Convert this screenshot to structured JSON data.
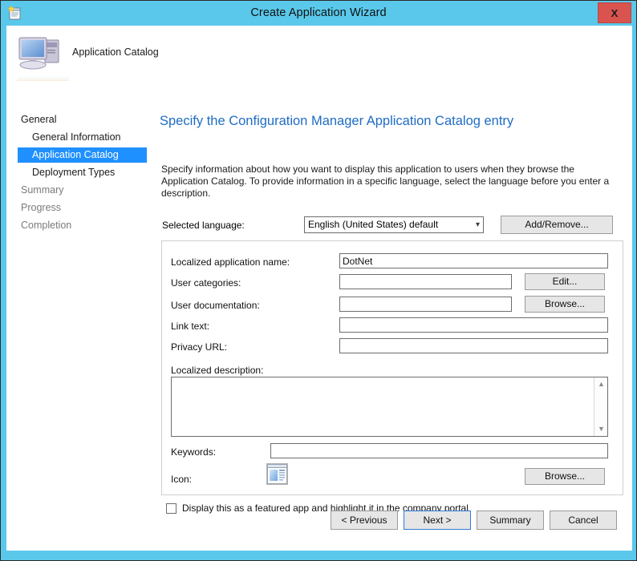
{
  "window": {
    "title": "Create Application Wizard",
    "close_label": "X",
    "icon": "wizard-document-icon",
    "titlebar_color": "#5ac8ea",
    "close_color": "#d9534f"
  },
  "header": {
    "label": "Application Catalog",
    "icon": "computer-icon"
  },
  "sidebar": {
    "items": [
      {
        "label": "General",
        "level": "top",
        "state": "normal"
      },
      {
        "label": "General Information",
        "level": "sub",
        "state": "normal"
      },
      {
        "label": "Application Catalog",
        "level": "sub",
        "state": "selected"
      },
      {
        "label": "Deployment Types",
        "level": "sub",
        "state": "normal"
      },
      {
        "label": "Summary",
        "level": "top",
        "state": "dim"
      },
      {
        "label": "Progress",
        "level": "top",
        "state": "dim"
      },
      {
        "label": "Completion",
        "level": "top",
        "state": "dim"
      }
    ],
    "selected_color": "#1f90ff"
  },
  "content": {
    "title": "Specify the Configuration Manager Application Catalog entry",
    "title_color": "#1f6cc4",
    "description": "Specify information about how you want to display this application to users when they browse the Application Catalog. To provide information in a specific language, select the language before you enter a description.",
    "language": {
      "label": "Selected language:",
      "selected": "English (United States) default",
      "options": [
        "English (United States) default"
      ],
      "add_remove_label": "Add/Remove..."
    },
    "fields": {
      "app_name_label": "Localized application name:",
      "app_name_value": "DotNet",
      "user_categories_label": "User categories:",
      "user_categories_value": "",
      "user_categories_button": "Edit...",
      "user_documentation_label": "User documentation:",
      "user_documentation_value": "",
      "user_documentation_button": "Browse...",
      "link_text_label": "Link text:",
      "link_text_value": "",
      "privacy_url_label": "Privacy URL:",
      "privacy_url_value": "",
      "description_label": "Localized description:",
      "description_value": "",
      "keywords_label": "Keywords:",
      "keywords_value": "",
      "icon_label": "Icon:",
      "icon_button": "Browse...",
      "icon_preview": "application-window-icon"
    },
    "featured_checkbox": {
      "label": "Display this as a featured app and highlight it in the company portal",
      "checked": false
    }
  },
  "footer": {
    "previous": "< Previous",
    "next": "Next >",
    "summary": "Summary",
    "cancel": "Cancel"
  }
}
